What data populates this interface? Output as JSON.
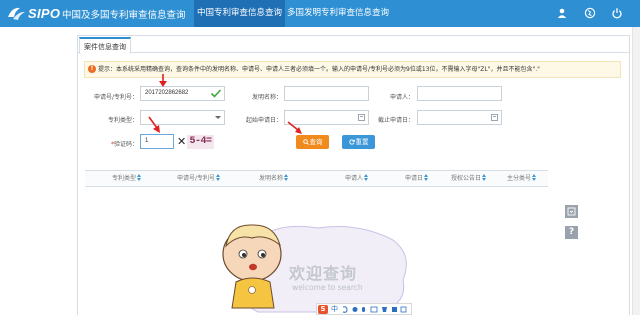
{
  "header": {
    "logo_text": "SIPO",
    "site_title": "中国及多国专利审查信息查询",
    "tabs": [
      {
        "label": "中国专利审查信息查询",
        "active": true
      },
      {
        "label": "多国发明专利审查信息查询",
        "active": false
      }
    ],
    "icons": [
      "user-icon",
      "globe-icon",
      "power-icon"
    ]
  },
  "panel": {
    "tab_label": "案件信息查询",
    "tip_icon": "!",
    "tip_text": "提示：本系统采用精确查询，查询条件中的发明名称、申请号、申请人三者必须填一个。输入的申请号/专利号必须为9位或13位，不需输入字母\"ZL\"，并且不能包含\".\""
  },
  "form": {
    "app_no_label": "申请号/专利号：",
    "app_no_value": "2017202862682",
    "invention_name_label": "发明名称：",
    "invention_name_value": "",
    "applicant_label": "申请人：",
    "applicant_value": "",
    "patent_type_label": "专利类型：",
    "patent_type_value": "",
    "start_date_label": "起始申请日：",
    "start_date_value": "",
    "end_date_label": "截止申请日：",
    "end_date_value": "",
    "captcha_required_mark": "*",
    "captcha_label": "验证码：",
    "captcha_value": "1",
    "captcha_clear": "✕",
    "captcha_image_text": "5-4=",
    "search_label": "查询",
    "reset_label": "重置"
  },
  "table": {
    "columns": [
      "专利类型",
      "申请号/专利号",
      "发明名称",
      "申请人",
      "申请日",
      "授权公告日",
      "主分类号"
    ]
  },
  "welcome": {
    "title_cn": "欢迎查询",
    "title_en": "welcome to search"
  },
  "ime": {
    "logo": "S",
    "mode": "中"
  },
  "side_tools": {
    "help_label": "?"
  },
  "colors": {
    "header_bg": "#2e8fd3",
    "active_tab_bg": "#1f6fb5",
    "search_button": "#f08a1c",
    "reset_button": "#3b97d8",
    "required_mark": "#d9342b",
    "annotation_arrow": "#e02020"
  }
}
